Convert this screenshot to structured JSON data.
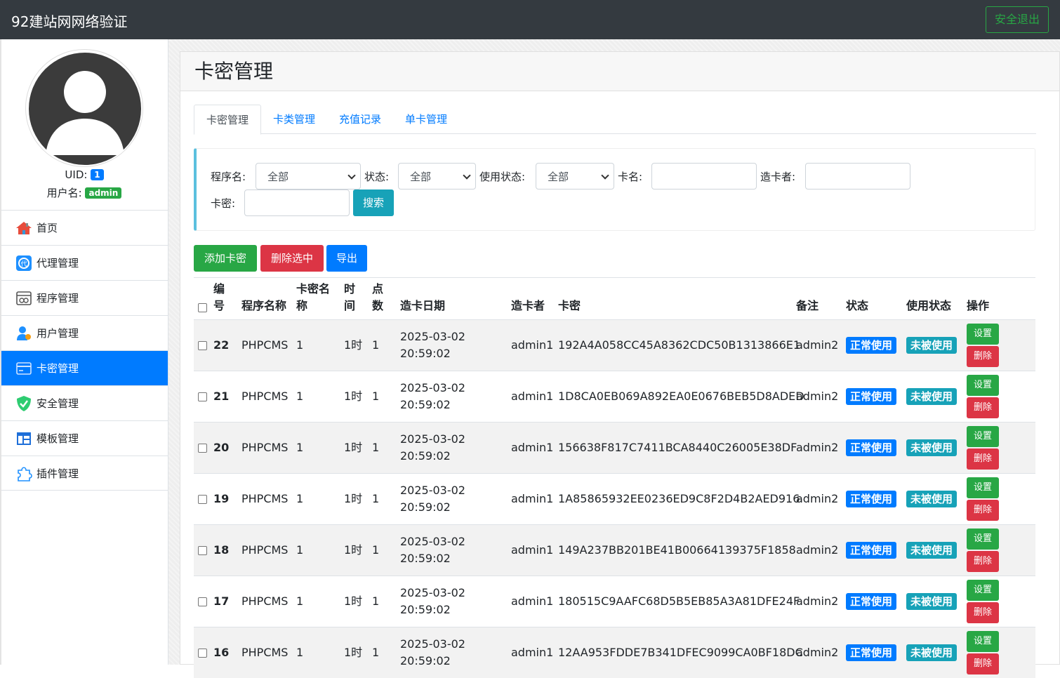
{
  "app": {
    "title": "92建站网网络验证",
    "logout_label": "安全退出"
  },
  "user": {
    "uid_label": "UID:",
    "uid": "1",
    "username_label": "用户名:",
    "username": "admin"
  },
  "menu": [
    {
      "label": "首页",
      "icon": "home-icon"
    },
    {
      "label": "代理管理",
      "icon": "agent-icon"
    },
    {
      "label": "程序管理",
      "icon": "program-icon"
    },
    {
      "label": "用户管理",
      "icon": "user-icon"
    },
    {
      "label": "卡密管理",
      "icon": "card-icon",
      "active": true
    },
    {
      "label": "安全管理",
      "icon": "shield-icon"
    },
    {
      "label": "模板管理",
      "icon": "template-icon"
    },
    {
      "label": "插件管理",
      "icon": "plugin-icon"
    }
  ],
  "page": {
    "title": "卡密管理"
  },
  "tabs": [
    "卡密管理",
    "卡类管理",
    "充值记录",
    "单卡管理"
  ],
  "filter": {
    "program_label": "程序名:",
    "program_value": "全部",
    "status_label": "状态:",
    "status_value": "全部",
    "use_status_label": "使用状态:",
    "use_status_value": "全部",
    "card_name_label": "卡名:",
    "card_name_value": "",
    "creator_label": "造卡者:",
    "creator_value": "",
    "card_key_label": "卡密:",
    "card_key_value": "",
    "search_label": "搜索"
  },
  "actions": {
    "add": "添加卡密",
    "delete_selected": "删除选中",
    "export": "导出"
  },
  "table": {
    "headers": {
      "id": [
        "编",
        "号"
      ],
      "program": "程序名称",
      "card_name": [
        "卡密名",
        "称"
      ],
      "time": [
        "时",
        "间"
      ],
      "points": [
        "点",
        "数"
      ],
      "date": "造卡日期",
      "creator": "造卡者",
      "key": "卡密",
      "note": "备注",
      "status": "状态",
      "use_status": "使用状态",
      "ops": "操作"
    },
    "rows": [
      {
        "id": "22",
        "program": "PHPCMS",
        "card_name": "1",
        "time": "1时",
        "points": "1",
        "date": "2025-03-02",
        "clock": "20:59:02",
        "creator": "admin1",
        "key": "192A4A058CC45A8362CDC50B1313866E1",
        "note": "admin2",
        "status": "正常使用",
        "use_status": "未被使用",
        "op1": "设置",
        "op2": "删除"
      },
      {
        "id": "21",
        "program": "PHPCMS",
        "card_name": "1",
        "time": "1时",
        "points": "1",
        "date": "2025-03-02",
        "clock": "20:59:02",
        "creator": "admin1",
        "key": "1D8CA0EB069A892EA0E0676BEB5D8ADED",
        "note": "admin2",
        "status": "正常使用",
        "use_status": "未被使用",
        "op1": "设置",
        "op2": "删除"
      },
      {
        "id": "20",
        "program": "PHPCMS",
        "card_name": "1",
        "time": "1时",
        "points": "1",
        "date": "2025-03-02",
        "clock": "20:59:02",
        "creator": "admin1",
        "key": "156638F817C7411BCA8440C26005E38DF",
        "note": "admin2",
        "status": "正常使用",
        "use_status": "未被使用",
        "op1": "设置",
        "op2": "删除"
      },
      {
        "id": "19",
        "program": "PHPCMS",
        "card_name": "1",
        "time": "1时",
        "points": "1",
        "date": "2025-03-02",
        "clock": "20:59:02",
        "creator": "admin1",
        "key": "1A85865932EE0236ED9C8F2D4B2AED916",
        "note": "admin2",
        "status": "正常使用",
        "use_status": "未被使用",
        "op1": "设置",
        "op2": "删除"
      },
      {
        "id": "18",
        "program": "PHPCMS",
        "card_name": "1",
        "time": "1时",
        "points": "1",
        "date": "2025-03-02",
        "clock": "20:59:02",
        "creator": "admin1",
        "key": "149A237BB201BE41B00664139375F1858",
        "note": "admin2",
        "status": "正常使用",
        "use_status": "未被使用",
        "op1": "设置",
        "op2": "删除"
      },
      {
        "id": "17",
        "program": "PHPCMS",
        "card_name": "1",
        "time": "1时",
        "points": "1",
        "date": "2025-03-02",
        "clock": "20:59:02",
        "creator": "admin1",
        "key": "180515C9AAFC68D5B5EB85A3A81DFE24F",
        "note": "admin2",
        "status": "正常使用",
        "use_status": "未被使用",
        "op1": "设置",
        "op2": "删除"
      },
      {
        "id": "16",
        "program": "PHPCMS",
        "card_name": "1",
        "time": "1时",
        "points": "1",
        "date": "2025-03-02",
        "clock": "20:59:02",
        "creator": "admin1",
        "key": "12AA953FDDE7B341DFEC9099CA0BF18DC",
        "note": "admin2",
        "status": "正常使用",
        "use_status": "未被使用",
        "op1": "设置",
        "op2": "删除"
      }
    ]
  },
  "colors": {
    "primary": "#007bff",
    "success": "#28a745",
    "danger": "#dc3545",
    "info": "#17a2b8",
    "topbar": "#343a40"
  }
}
